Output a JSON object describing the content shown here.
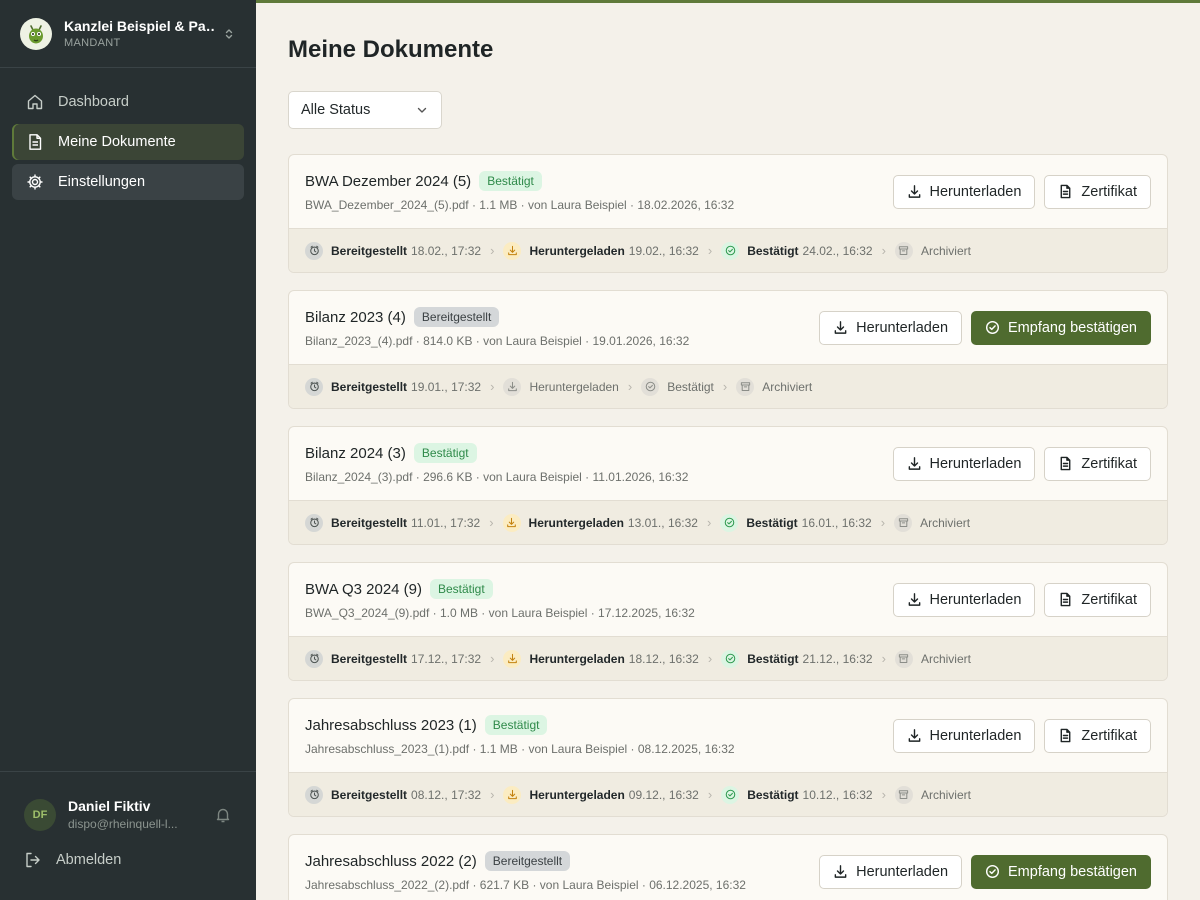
{
  "brand": {
    "name": "Kanzlei Beispiel & Par...",
    "role": "MANDANT"
  },
  "nav": [
    {
      "label": "Dashboard",
      "icon": "home-icon"
    },
    {
      "label": "Meine Dokumente",
      "icon": "document-icon"
    },
    {
      "label": "Einstellungen",
      "icon": "gear-icon"
    }
  ],
  "user": {
    "initials": "DF",
    "name": "Daniel Fiktiv",
    "email": "dispo@rheinquell-l..."
  },
  "logout_label": "Abmelden",
  "page": {
    "title": "Meine Dokumente",
    "filter_value": "Alle Status"
  },
  "colors": {
    "accent": "#4f6b2f",
    "sidebar": "#283032",
    "background": "#f4f1ea"
  },
  "documents": [
    {
      "title": "BWA Dezember 2024 (5)",
      "status": "Bestätigt",
      "meta": "BWA_Dezember_2024_(5).pdf · 1.1 MB · von Laura Beispiel · 18.02.2026, 16:32",
      "btn1": "Herunterladen",
      "btn2": "Zertifikat",
      "steps": [
        {
          "label": "Bereitgestellt",
          "date": "18.02., 17:32"
        },
        {
          "label": "Heruntergeladen",
          "date": "19.02., 16:32"
        },
        {
          "label": "Bestätigt",
          "date": "24.02., 16:32"
        },
        {
          "label": "Archiviert",
          "date": ""
        }
      ]
    },
    {
      "title": "Bilanz 2023 (4)",
      "status": "Bereitgestellt",
      "meta": "Bilanz_2023_(4).pdf · 814.0 KB · von Laura Beispiel · 19.01.2026, 16:32",
      "btn1": "Herunterladen",
      "btn2": "Empfang bestätigen",
      "steps": [
        {
          "label": "Bereitgestellt",
          "date": "19.01., 17:32"
        },
        {
          "label": "Heruntergeladen",
          "date": ""
        },
        {
          "label": "Bestätigt",
          "date": ""
        },
        {
          "label": "Archiviert",
          "date": ""
        }
      ]
    },
    {
      "title": "Bilanz 2024 (3)",
      "status": "Bestätigt",
      "meta": "Bilanz_2024_(3).pdf · 296.6 KB · von Laura Beispiel · 11.01.2026, 16:32",
      "btn1": "Herunterladen",
      "btn2": "Zertifikat",
      "steps": [
        {
          "label": "Bereitgestellt",
          "date": "11.01., 17:32"
        },
        {
          "label": "Heruntergeladen",
          "date": "13.01., 16:32"
        },
        {
          "label": "Bestätigt",
          "date": "16.01., 16:32"
        },
        {
          "label": "Archiviert",
          "date": ""
        }
      ]
    },
    {
      "title": "BWA Q3 2024 (9)",
      "status": "Bestätigt",
      "meta": "BWA_Q3_2024_(9).pdf · 1.0 MB · von Laura Beispiel · 17.12.2025, 16:32",
      "btn1": "Herunterladen",
      "btn2": "Zertifikat",
      "steps": [
        {
          "label": "Bereitgestellt",
          "date": "17.12., 17:32"
        },
        {
          "label": "Heruntergeladen",
          "date": "18.12., 16:32"
        },
        {
          "label": "Bestätigt",
          "date": "21.12., 16:32"
        },
        {
          "label": "Archiviert",
          "date": ""
        }
      ]
    },
    {
      "title": "Jahresabschluss 2023 (1)",
      "status": "Bestätigt",
      "meta": "Jahresabschluss_2023_(1).pdf · 1.1 MB · von Laura Beispiel · 08.12.2025, 16:32",
      "btn1": "Herunterladen",
      "btn2": "Zertifikat",
      "steps": [
        {
          "label": "Bereitgestellt",
          "date": "08.12., 17:32"
        },
        {
          "label": "Heruntergeladen",
          "date": "09.12., 16:32"
        },
        {
          "label": "Bestätigt",
          "date": "10.12., 16:32"
        },
        {
          "label": "Archiviert",
          "date": ""
        }
      ]
    },
    {
      "title": "Jahresabschluss 2022 (2)",
      "status": "Bereitgestellt",
      "meta": "Jahresabschluss_2022_(2).pdf · 621.7 KB · von Laura Beispiel · 06.12.2025, 16:32",
      "btn1": "Herunterladen",
      "btn2": "Empfang bestätigen",
      "steps": []
    }
  ]
}
